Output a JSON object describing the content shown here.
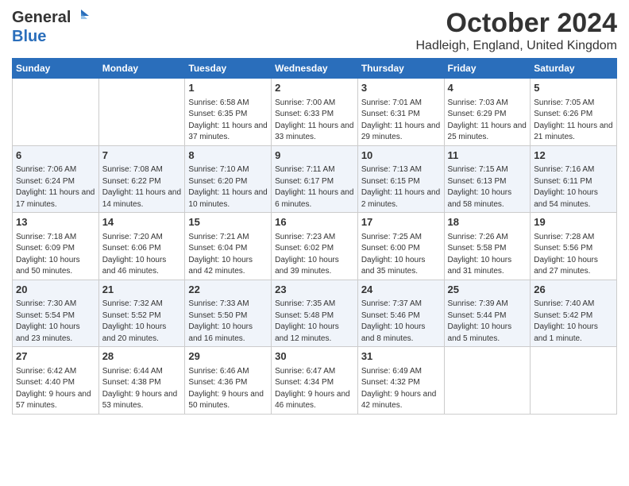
{
  "logo": {
    "line1": "General",
    "line2": "Blue"
  },
  "title": "October 2024",
  "subtitle": "Hadleigh, England, United Kingdom",
  "days_of_week": [
    "Sunday",
    "Monday",
    "Tuesday",
    "Wednesday",
    "Thursday",
    "Friday",
    "Saturday"
  ],
  "weeks": [
    [
      {
        "day": "",
        "info": ""
      },
      {
        "day": "",
        "info": ""
      },
      {
        "day": "1",
        "info": "Sunrise: 6:58 AM\nSunset: 6:35 PM\nDaylight: 11 hours and 37 minutes."
      },
      {
        "day": "2",
        "info": "Sunrise: 7:00 AM\nSunset: 6:33 PM\nDaylight: 11 hours and 33 minutes."
      },
      {
        "day": "3",
        "info": "Sunrise: 7:01 AM\nSunset: 6:31 PM\nDaylight: 11 hours and 29 minutes."
      },
      {
        "day": "4",
        "info": "Sunrise: 7:03 AM\nSunset: 6:29 PM\nDaylight: 11 hours and 25 minutes."
      },
      {
        "day": "5",
        "info": "Sunrise: 7:05 AM\nSunset: 6:26 PM\nDaylight: 11 hours and 21 minutes."
      }
    ],
    [
      {
        "day": "6",
        "info": "Sunrise: 7:06 AM\nSunset: 6:24 PM\nDaylight: 11 hours and 17 minutes."
      },
      {
        "day": "7",
        "info": "Sunrise: 7:08 AM\nSunset: 6:22 PM\nDaylight: 11 hours and 14 minutes."
      },
      {
        "day": "8",
        "info": "Sunrise: 7:10 AM\nSunset: 6:20 PM\nDaylight: 11 hours and 10 minutes."
      },
      {
        "day": "9",
        "info": "Sunrise: 7:11 AM\nSunset: 6:17 PM\nDaylight: 11 hours and 6 minutes."
      },
      {
        "day": "10",
        "info": "Sunrise: 7:13 AM\nSunset: 6:15 PM\nDaylight: 11 hours and 2 minutes."
      },
      {
        "day": "11",
        "info": "Sunrise: 7:15 AM\nSunset: 6:13 PM\nDaylight: 10 hours and 58 minutes."
      },
      {
        "day": "12",
        "info": "Sunrise: 7:16 AM\nSunset: 6:11 PM\nDaylight: 10 hours and 54 minutes."
      }
    ],
    [
      {
        "day": "13",
        "info": "Sunrise: 7:18 AM\nSunset: 6:09 PM\nDaylight: 10 hours and 50 minutes."
      },
      {
        "day": "14",
        "info": "Sunrise: 7:20 AM\nSunset: 6:06 PM\nDaylight: 10 hours and 46 minutes."
      },
      {
        "day": "15",
        "info": "Sunrise: 7:21 AM\nSunset: 6:04 PM\nDaylight: 10 hours and 42 minutes."
      },
      {
        "day": "16",
        "info": "Sunrise: 7:23 AM\nSunset: 6:02 PM\nDaylight: 10 hours and 39 minutes."
      },
      {
        "day": "17",
        "info": "Sunrise: 7:25 AM\nSunset: 6:00 PM\nDaylight: 10 hours and 35 minutes."
      },
      {
        "day": "18",
        "info": "Sunrise: 7:26 AM\nSunset: 5:58 PM\nDaylight: 10 hours and 31 minutes."
      },
      {
        "day": "19",
        "info": "Sunrise: 7:28 AM\nSunset: 5:56 PM\nDaylight: 10 hours and 27 minutes."
      }
    ],
    [
      {
        "day": "20",
        "info": "Sunrise: 7:30 AM\nSunset: 5:54 PM\nDaylight: 10 hours and 23 minutes."
      },
      {
        "day": "21",
        "info": "Sunrise: 7:32 AM\nSunset: 5:52 PM\nDaylight: 10 hours and 20 minutes."
      },
      {
        "day": "22",
        "info": "Sunrise: 7:33 AM\nSunset: 5:50 PM\nDaylight: 10 hours and 16 minutes."
      },
      {
        "day": "23",
        "info": "Sunrise: 7:35 AM\nSunset: 5:48 PM\nDaylight: 10 hours and 12 minutes."
      },
      {
        "day": "24",
        "info": "Sunrise: 7:37 AM\nSunset: 5:46 PM\nDaylight: 10 hours and 8 minutes."
      },
      {
        "day": "25",
        "info": "Sunrise: 7:39 AM\nSunset: 5:44 PM\nDaylight: 10 hours and 5 minutes."
      },
      {
        "day": "26",
        "info": "Sunrise: 7:40 AM\nSunset: 5:42 PM\nDaylight: 10 hours and 1 minute."
      }
    ],
    [
      {
        "day": "27",
        "info": "Sunrise: 6:42 AM\nSunset: 4:40 PM\nDaylight: 9 hours and 57 minutes."
      },
      {
        "day": "28",
        "info": "Sunrise: 6:44 AM\nSunset: 4:38 PM\nDaylight: 9 hours and 53 minutes."
      },
      {
        "day": "29",
        "info": "Sunrise: 6:46 AM\nSunset: 4:36 PM\nDaylight: 9 hours and 50 minutes."
      },
      {
        "day": "30",
        "info": "Sunrise: 6:47 AM\nSunset: 4:34 PM\nDaylight: 9 hours and 46 minutes."
      },
      {
        "day": "31",
        "info": "Sunrise: 6:49 AM\nSunset: 4:32 PM\nDaylight: 9 hours and 42 minutes."
      },
      {
        "day": "",
        "info": ""
      },
      {
        "day": "",
        "info": ""
      }
    ]
  ]
}
